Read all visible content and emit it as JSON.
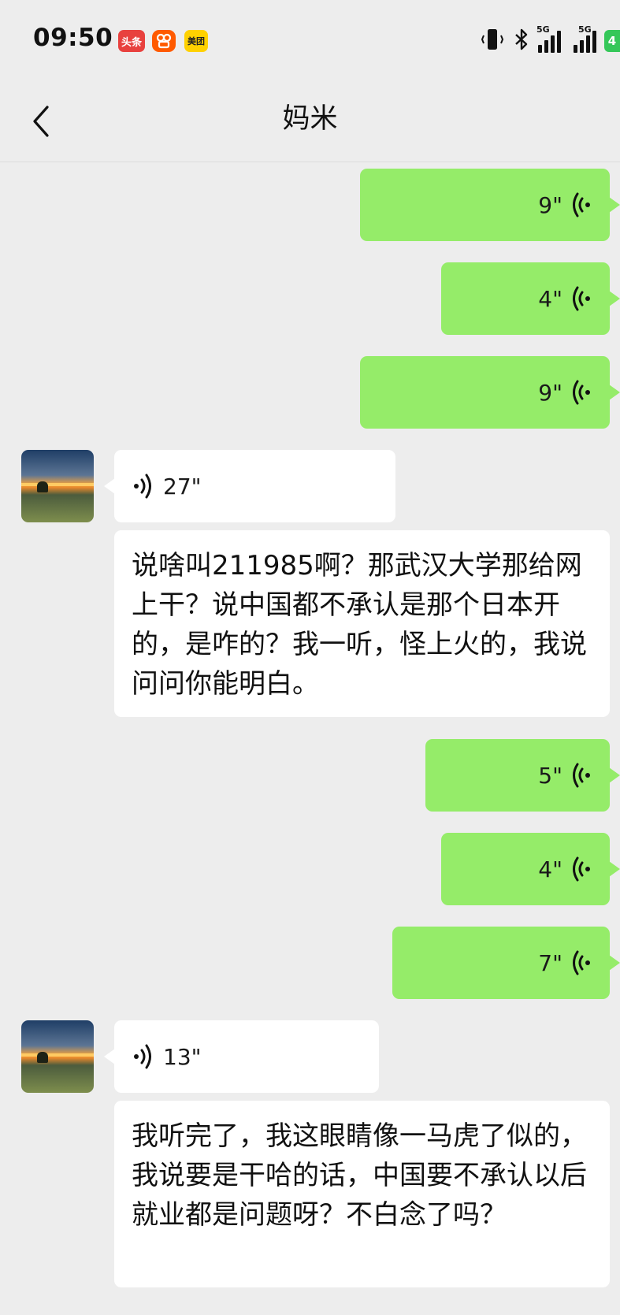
{
  "status_bar": {
    "time": "09:50",
    "apps": [
      "头条",
      "快手",
      "美团"
    ],
    "network_1": "5G",
    "network_2": "5G",
    "battery_level": "4"
  },
  "header": {
    "title": "妈米"
  },
  "messages": [
    {
      "sender": "me",
      "type": "voice",
      "duration": "9\""
    },
    {
      "sender": "me",
      "type": "voice",
      "duration": "4\""
    },
    {
      "sender": "me",
      "type": "voice",
      "duration": "9\""
    },
    {
      "sender": "other",
      "type": "voice",
      "duration": "27\"",
      "transcript": "说啥叫211985啊？那武汉大学那给网上干？说中国都不承认是那个日本开的，是咋的？我一听，怪上火的，我说问问你能明白。"
    },
    {
      "sender": "me",
      "type": "voice",
      "duration": "5\""
    },
    {
      "sender": "me",
      "type": "voice",
      "duration": "4\""
    },
    {
      "sender": "me",
      "type": "voice",
      "duration": "7\""
    },
    {
      "sender": "other",
      "type": "voice",
      "duration": "13\"",
      "transcript": "我听完了，我这眼睛像一马虎了似的，我说要是干哈的话，中国要不承认以后就业都是问题呀？不白念了吗？"
    }
  ],
  "icons": {
    "back": "chevron-left-icon",
    "voice_sent": "voice-wave-icon",
    "voice_received": "voice-wave-icon"
  },
  "colors": {
    "sent_bubble": "#95ec69",
    "received_bubble": "#ffffff",
    "background": "#ededed"
  }
}
